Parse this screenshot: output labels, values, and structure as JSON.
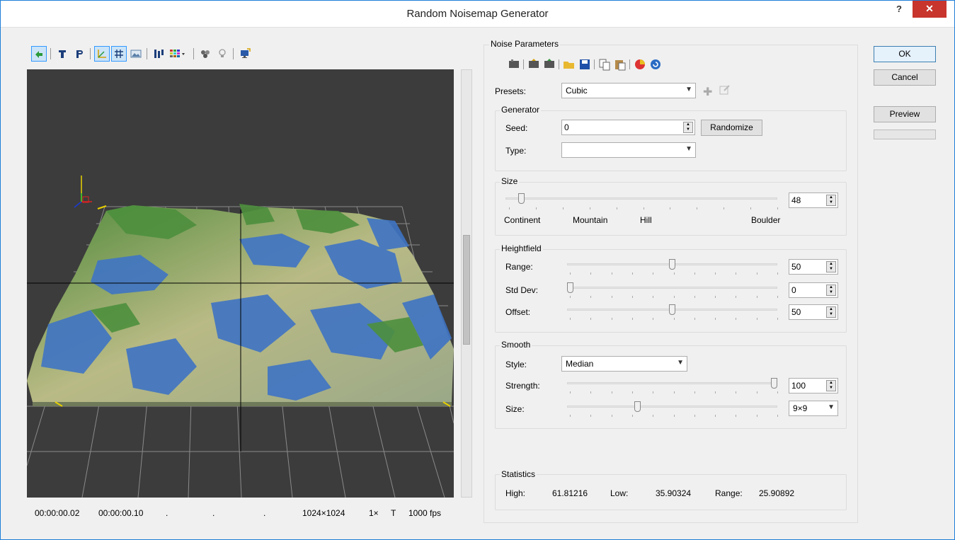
{
  "window": {
    "title": "Random Noisemap Generator",
    "help_label": "?",
    "close_label": "✕"
  },
  "toolbar": {
    "icons": [
      "reset-view-icon",
      "text-t-icon",
      "text-p-icon",
      "axes-icon",
      "grid-icon",
      "terrain-icon",
      "split-icon",
      "palette-icon",
      "render-icon",
      "light-icon",
      "export-icon"
    ],
    "active": [
      "reset-view-icon",
      "axes-icon",
      "grid-icon"
    ]
  },
  "statusbar": {
    "time1": "00:00:00.02",
    "time2": "00:00:00.10",
    "dot1": ".",
    "dot2": ".",
    "dot3": ".",
    "resolution": "1024×1024",
    "zoom": "1×",
    "mode": "T",
    "fps": "1000 fps"
  },
  "params": {
    "title": "Noise Parameters",
    "presets_label": "Presets:",
    "presets_value": "Cubic"
  },
  "generator": {
    "title": "Generator",
    "seed_label": "Seed:",
    "seed_value": "0",
    "randomize_label": "Randomize",
    "type_label": "Type:",
    "type_value": ""
  },
  "size": {
    "title": "Size",
    "value": "48",
    "level": 0.02,
    "labels": [
      "Continent",
      "Mountain",
      "Hill",
      "Boulder"
    ]
  },
  "heightfield": {
    "title": "Heightfield",
    "rows": [
      {
        "label": "Range:",
        "value": "50",
        "level": 0.5
      },
      {
        "label": "Std Dev:",
        "value": "0",
        "level": 0.0
      },
      {
        "label": "Offset:",
        "value": "50",
        "level": 0.5
      }
    ]
  },
  "smooth": {
    "title": "Smooth",
    "style_label": "Style:",
    "style_value": "Median",
    "strength_label": "Strength:",
    "strength_value": "100",
    "strength_level": 1.0,
    "size_label": "Size:",
    "size_value": "9×9",
    "size_level": 0.33
  },
  "statistics": {
    "title": "Statistics",
    "high_label": "High:",
    "high_value": "61.81216",
    "low_label": "Low:",
    "low_value": "35.90324",
    "range_label": "Range:",
    "range_value": "25.90892"
  },
  "buttons": {
    "ok": "OK",
    "cancel": "Cancel",
    "preview": "Preview"
  },
  "colors": {
    "accent": "#3399ff",
    "close": "#c7352c",
    "viewport_bg": "#3c3c3c"
  }
}
